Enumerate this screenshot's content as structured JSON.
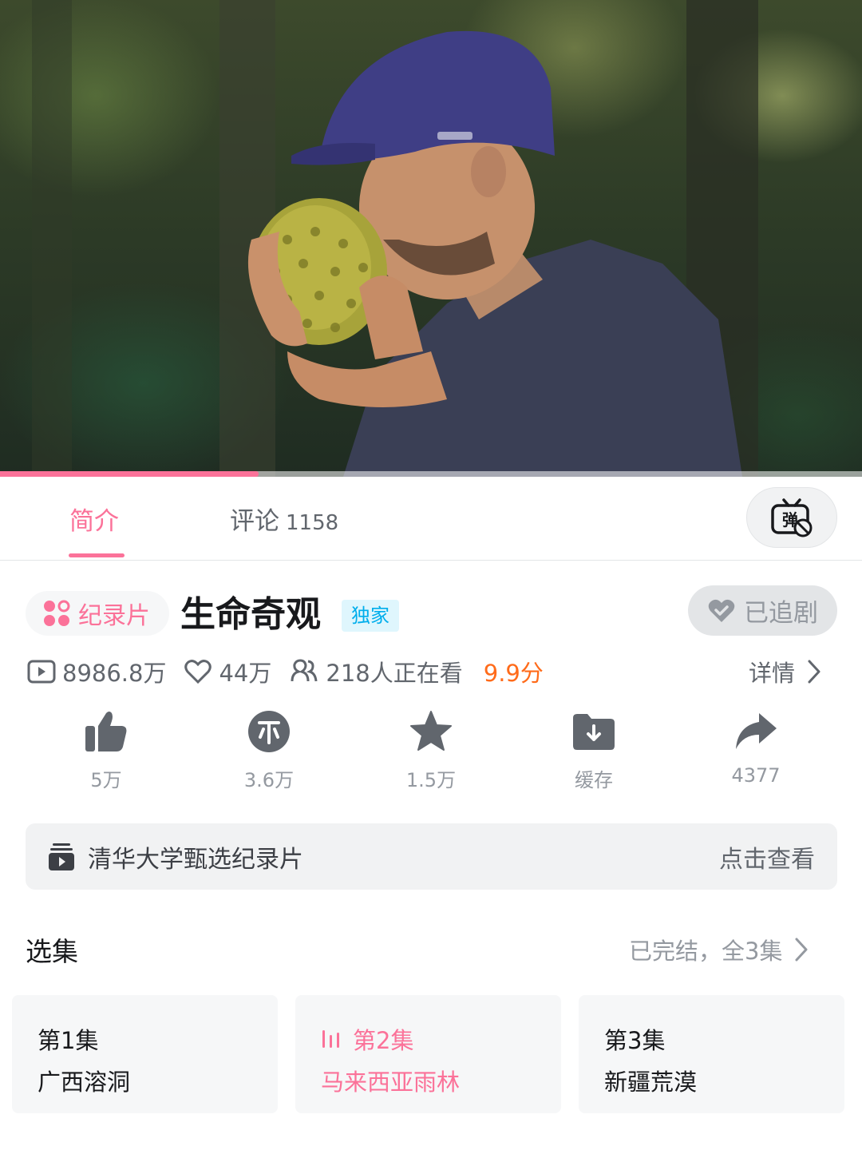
{
  "video": {
    "progress_fraction": 0.3
  },
  "tabs": {
    "intro_label": "简介",
    "comment_label": "评论",
    "comment_count": "1158",
    "danmaku_icon": "danmaku-off-icon"
  },
  "info": {
    "category": "纪录片",
    "title": "生命奇观",
    "badge": "独家",
    "follow_label": "已追剧",
    "views": "8986.8万",
    "likes_count": "44万",
    "watching": "218人正在看",
    "score": "9.9分",
    "details_label": "详情"
  },
  "actions": [
    {
      "icon": "thumbs-up-icon",
      "label": "5万"
    },
    {
      "icon": "coin-icon",
      "label": "3.6万"
    },
    {
      "icon": "star-icon",
      "label": "1.5万"
    },
    {
      "icon": "download-folder-icon",
      "label": "缓存"
    },
    {
      "icon": "share-icon",
      "label": "4377"
    }
  ],
  "banner": {
    "icon": "playlist-icon",
    "text": "清华大学甄选纪录片",
    "action": "点击查看"
  },
  "episodes": {
    "section_title": "选集",
    "status": "已完结，全3集",
    "items": [
      {
        "number": "第1集",
        "name": "广西溶洞",
        "active": false
      },
      {
        "number": "第2集",
        "name": "马来西亚雨林",
        "active": true
      },
      {
        "number": "第3集",
        "name": "新疆荒漠",
        "active": false
      }
    ]
  },
  "colors": {
    "accent": "#fb7299",
    "score": "#ff6b1a",
    "badge": "#00aeec"
  }
}
